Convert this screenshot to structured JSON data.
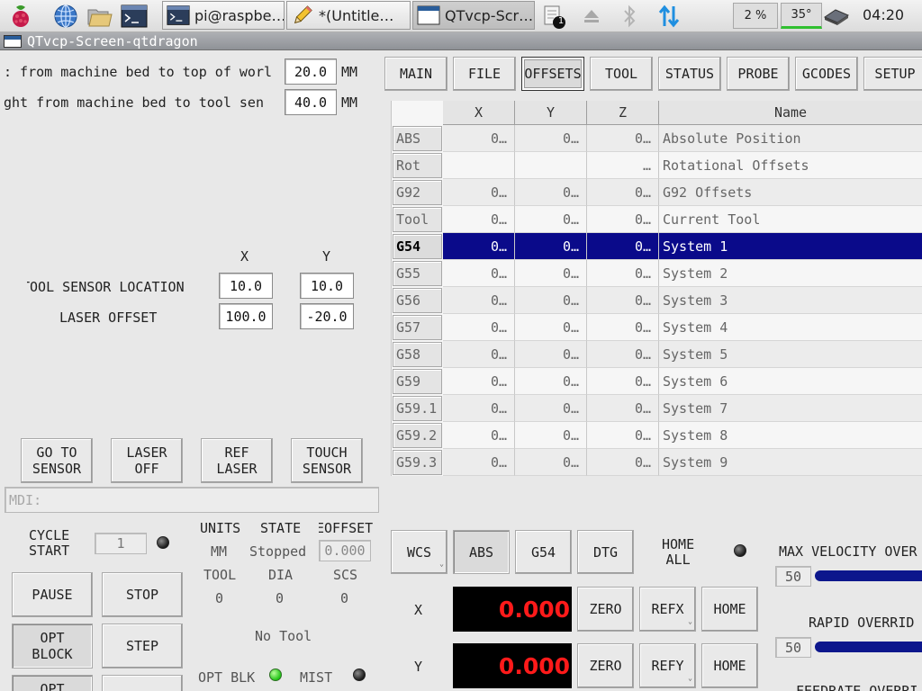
{
  "taskbar": {
    "tasks": [
      {
        "label": "pi@raspbe…"
      },
      {
        "label": "*(Untitle…"
      },
      {
        "label": "QTvcp-Scr…"
      }
    ],
    "notification_count": "1",
    "cpu": "2 %",
    "temperature": "35°",
    "clock": "04:20"
  },
  "window": {
    "title": "QTvcp-Screen-qtdragon"
  },
  "params": {
    "rows": [
      {
        "label": ": from machine bed to top of worl",
        "value": "20.0",
        "unit": "MM"
      },
      {
        "label": "ght from machine bed to tool sen",
        "value": "40.0",
        "unit": "MM"
      }
    ]
  },
  "sensor": {
    "x_header": "X",
    "y_header": "Y",
    "tool_sensor_label": "TOOL SENSOR LOCATION",
    "tool_sensor_x": "10.0",
    "tool_sensor_y": "10.0",
    "laser_label": "LASER OFFSET",
    "laser_x": "100.0",
    "laser_y": "-20.0"
  },
  "action_buttons": {
    "go_to_sensor": "GO TO\nSENSOR",
    "laser_off": "LASER\nOFF",
    "ref_laser": "REF\nLASER",
    "touch_sensor": "TOUCH\nSENSOR"
  },
  "mdi": {
    "placeholder": "MDI:"
  },
  "status": {
    "cycle_start": "CYCLE\nSTART",
    "cycle_count": "1",
    "units_label": "UNITS",
    "units_value": "MM",
    "state_label": "STATE",
    "state_value": "Stopped",
    "eoffset_label": "EOFFSET",
    "eoffset_value": "0.000",
    "tool_label": "TOOL",
    "tool_value": "0",
    "dia_label": "DIA",
    "dia_value": "0",
    "scs_label": "SCS",
    "scs_value": "0",
    "tool_desc": "No Tool",
    "opt_blk_label": "OPT BLK",
    "mist_label": "MIST"
  },
  "controls": {
    "pause": "PAUSE",
    "stop": "STOP",
    "opt_block": "OPT\nBLOCK",
    "step": "STEP",
    "opt_partial": "OPT"
  },
  "tabs": [
    {
      "label": "MAIN"
    },
    {
      "label": "FILE"
    },
    {
      "label": "OFFSETS"
    },
    {
      "label": "TOOL"
    },
    {
      "label": "STATUS"
    },
    {
      "label": "PROBE"
    },
    {
      "label": "GCODES"
    },
    {
      "label": "SETUP"
    }
  ],
  "offsets": {
    "headers": [
      "X",
      "Y",
      "Z",
      "Name"
    ],
    "rows": [
      {
        "id": "ABS",
        "x": "0…",
        "y": "0…",
        "z": "0…",
        "name": "Absolute Position"
      },
      {
        "id": "Rot",
        "x": "",
        "y": "",
        "z": "…",
        "name": "Rotational Offsets"
      },
      {
        "id": "G92",
        "x": "0…",
        "y": "0…",
        "z": "0…",
        "name": "G92 Offsets"
      },
      {
        "id": "Tool",
        "x": "0…",
        "y": "0…",
        "z": "0…",
        "name": "Current Tool"
      },
      {
        "id": "G54",
        "x": "0…",
        "y": "0…",
        "z": "0…",
        "name": "System 1",
        "selected": true
      },
      {
        "id": "G55",
        "x": "0…",
        "y": "0…",
        "z": "0…",
        "name": "System 2"
      },
      {
        "id": "G56",
        "x": "0…",
        "y": "0…",
        "z": "0…",
        "name": "System 3"
      },
      {
        "id": "G57",
        "x": "0…",
        "y": "0…",
        "z": "0…",
        "name": "System 4"
      },
      {
        "id": "G58",
        "x": "0…",
        "y": "0…",
        "z": "0…",
        "name": "System 5"
      },
      {
        "id": "G59",
        "x": "0…",
        "y": "0…",
        "z": "0…",
        "name": "System 6"
      },
      {
        "id": "G59.1",
        "x": "0…",
        "y": "0…",
        "z": "0…",
        "name": "System 7"
      },
      {
        "id": "G59.2",
        "x": "0…",
        "y": "0…",
        "z": "0…",
        "name": "System 8"
      },
      {
        "id": "G59.3",
        "x": "0…",
        "y": "0…",
        "z": "0…",
        "name": "System 9"
      }
    ]
  },
  "dro": {
    "wcs": "WCS",
    "abs": "ABS",
    "g54": "G54",
    "dtg": "DTG",
    "home_all": "HOME\nALL",
    "axes": [
      {
        "axis": "X",
        "value": "0.000",
        "zero": "ZERO",
        "ref": "REFX",
        "home": "HOME"
      },
      {
        "axis": "Y",
        "value": "0.000",
        "zero": "ZERO",
        "ref": "REFY",
        "home": "HOME"
      }
    ]
  },
  "overrides": {
    "max_velocity_label": "MAX VELOCITY OVER",
    "max_velocity_value": "50",
    "max_velocity_fraction": 0.5,
    "rapid_label": "RAPID OVERRID",
    "rapid_value": "50",
    "rapid_fraction": 0.5,
    "feedrate_label": "FEEDRATE OVERRI"
  },
  "colors": {
    "selection": "#0a0a8a",
    "dro_text": "#ff1a1a",
    "led_on": "#22c416",
    "slider": "#0c168c"
  }
}
